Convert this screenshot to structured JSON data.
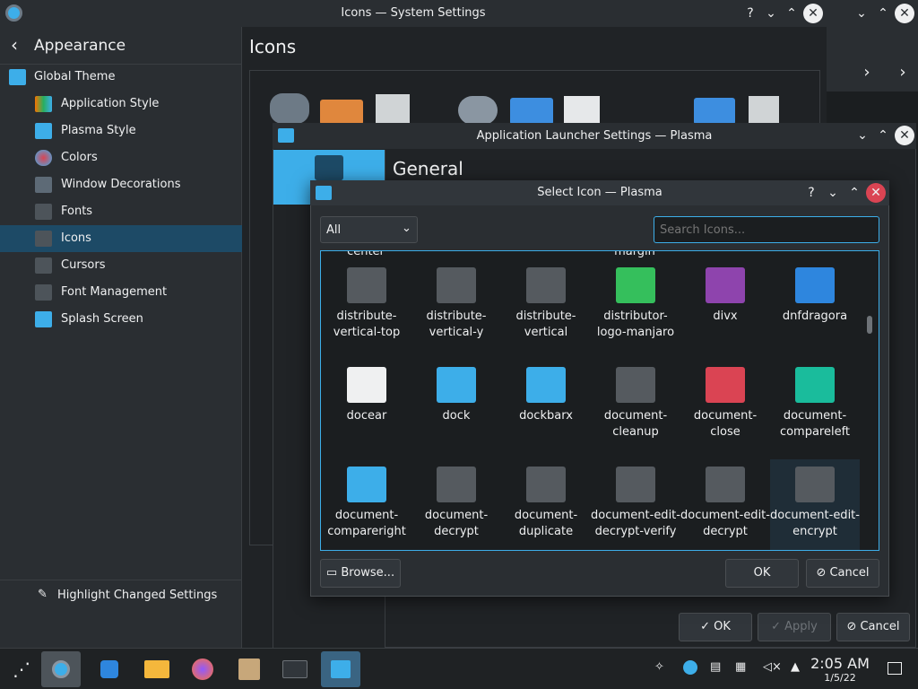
{
  "system_settings": {
    "title": "Icons — System Settings",
    "back_label": "Appearance",
    "page_title": "Icons",
    "sidebar": [
      {
        "label": "Global Theme",
        "icon": "global-theme-icon"
      },
      {
        "label": "Application Style",
        "icon": "application-style-icon"
      },
      {
        "label": "Plasma Style",
        "icon": "plasma-style-icon"
      },
      {
        "label": "Colors",
        "icon": "colors-icon"
      },
      {
        "label": "Window Decorations",
        "icon": "window-decorations-icon"
      },
      {
        "label": "Fonts",
        "icon": "fonts-icon"
      },
      {
        "label": "Icons",
        "icon": "icons-icon"
      },
      {
        "label": "Cursors",
        "icon": "cursors-icon"
      },
      {
        "label": "Font Management",
        "icon": "font-management-icon"
      },
      {
        "label": "Splash Screen",
        "icon": "splash-screen-icon"
      }
    ],
    "highlight_label": "Highlight Changed Settings"
  },
  "launcher": {
    "title": "Application Launcher Settings — Plasma",
    "section": "General",
    "ok": "OK",
    "apply": "Apply",
    "cancel": "Cancel"
  },
  "dialog": {
    "title": "Select Icon — Plasma",
    "filter": "All",
    "search_placeholder": "Search Icons...",
    "browse": "Browse...",
    "ok": "OK",
    "cancel": "Cancel",
    "partial_top": [
      "center",
      "margin"
    ],
    "icons": [
      {
        "label": "distribute-vertical-top",
        "color": "#555a5f"
      },
      {
        "label": "distribute-vertical-y",
        "color": "#555a5f"
      },
      {
        "label": "distribute-vertical",
        "color": "#555a5f"
      },
      {
        "label": "distributor-logo-manjaro",
        "color": "#35bf5c"
      },
      {
        "label": "divx",
        "color": "#8e44ad"
      },
      {
        "label": "dnfdragora",
        "color": "#2e86de"
      },
      {
        "label": "docear",
        "color": "#eff0f1"
      },
      {
        "label": "dock",
        "color": "#3daee9"
      },
      {
        "label": "dockbarx",
        "color": "#3daee9"
      },
      {
        "label": "document-cleanup",
        "color": "#555a5f"
      },
      {
        "label": "document-close",
        "color": "#da4453"
      },
      {
        "label": "document-compareleft",
        "color": "#1abc9c"
      },
      {
        "label": "document-compareright",
        "color": "#3daee9"
      },
      {
        "label": "document-decrypt",
        "color": "#555a5f"
      },
      {
        "label": "document-duplicate",
        "color": "#555a5f"
      },
      {
        "label": "document-edit-decrypt-verify",
        "color": "#555a5f"
      },
      {
        "label": "document-edit-decrypt",
        "color": "#555a5f"
      },
      {
        "label": "document-edit-encrypt",
        "color": "#555a5f"
      }
    ]
  },
  "taskbar": {
    "time": "2:05 AM",
    "date": "1/5/22"
  }
}
